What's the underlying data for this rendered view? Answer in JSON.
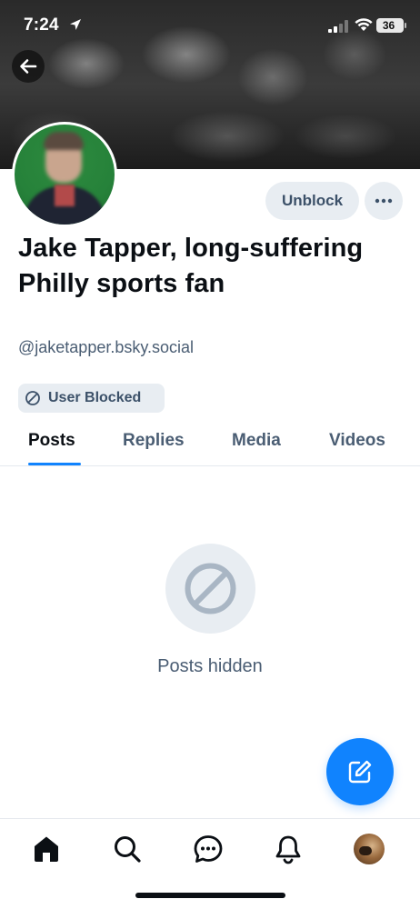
{
  "status_bar": {
    "time": "7:24",
    "battery": "36"
  },
  "profile": {
    "display_name": "Jake Tapper, long-suffering Philly sports fan",
    "handle": "@jaketapper.bsky.social",
    "unblock_label": "Unblock",
    "blocked_badge": "User Blocked"
  },
  "tabs": [
    {
      "label": "Posts",
      "active": true
    },
    {
      "label": "Replies",
      "active": false
    },
    {
      "label": "Media",
      "active": false
    },
    {
      "label": "Videos",
      "active": false
    }
  ],
  "empty_state": {
    "message": "Posts hidden",
    "icon": "blocked-icon"
  },
  "bottom_nav": [
    {
      "icon": "home-icon",
      "active": true
    },
    {
      "icon": "search-icon",
      "active": false
    },
    {
      "icon": "chat-icon",
      "active": false
    },
    {
      "icon": "bell-icon",
      "active": false
    },
    {
      "icon": "avatar",
      "active": false
    }
  ],
  "colors": {
    "accent": "#1083fe",
    "muted_text": "#4a5d73",
    "chip_background": "#e8edf2",
    "text": "#0b0f14"
  }
}
